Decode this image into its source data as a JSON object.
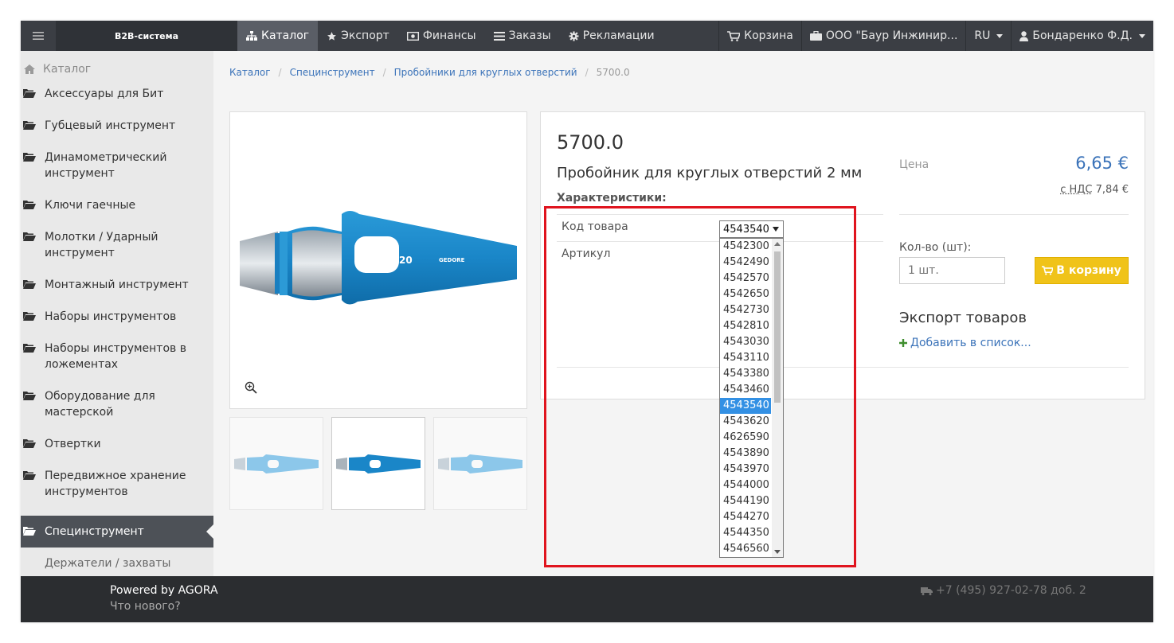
{
  "app": {
    "brand": "B2B-система"
  },
  "nav": {
    "items": [
      {
        "label": "Каталог",
        "icon": "sitemap-icon",
        "active": true
      },
      {
        "label": "Экспорт",
        "icon": "star-icon"
      },
      {
        "label": "Финансы",
        "icon": "money-icon"
      },
      {
        "label": "Заказы",
        "icon": "list-icon"
      },
      {
        "label": "Рекламации",
        "icon": "gear-icon"
      }
    ],
    "cart": "Корзина",
    "company": "ООО \"Баур Инжинир...",
    "lang": "RU",
    "user": "Бондаренко Ф.Д."
  },
  "sidebar": {
    "header": "Каталог",
    "items": [
      "Аксессуары для Бит",
      "Губцевый инструмент",
      "Динамометрический инструмент",
      "Ключи гаечные",
      "Молотки / Ударный инструмент",
      "Монтажный инструмент",
      "Наборы инструментов",
      "Наборы инструментов в ложементах",
      "Оборудование для мастерской",
      "Отвертки",
      "Передвижное хранение инструментов",
      "Специнструмент"
    ],
    "active_item": "Специнструмент",
    "sub_item": "Держатели / захваты"
  },
  "breadcrumb": {
    "items": [
      "Каталог",
      "Специнструмент",
      "Пробойники для круглых отверстий"
    ],
    "current": "5700.0"
  },
  "product": {
    "code": "5700.0",
    "name": "Пробойник для круглых отверстий 2 мм",
    "chars_label": "Характеристики:",
    "code_label": "Код товара",
    "article_label": "Артикул",
    "image_label_num": "20",
    "image_label_brand": "GEDORE"
  },
  "price": {
    "label": "Цена",
    "value": "6,65 €",
    "vat_label": "с НДС",
    "vat_value": "7,84 €"
  },
  "qty": {
    "label": "Кол-во (шт):",
    "placeholder": "1 шт."
  },
  "cart_button": "В корзину",
  "export": {
    "title": "Экспорт товаров",
    "add": "Добавить в список..."
  },
  "select": {
    "value": "4543540",
    "options": [
      "4542300",
      "4542490",
      "4542570",
      "4542650",
      "4542730",
      "4542810",
      "4543030",
      "4543110",
      "4543380",
      "4543460",
      "4543540",
      "4543620",
      "4626590",
      "4543890",
      "4543970",
      "4544000",
      "4544190",
      "4544270",
      "4544350",
      "4546560"
    ],
    "selected_index": 10
  },
  "footer": {
    "powered": "Powered by AGORA",
    "whats_new": "Что нового?",
    "phone": "+7 (495) 927-02-78 доб. 2"
  },
  "colors": {
    "topbar": "#3b3e44",
    "link": "#3b73b9",
    "cart_button": "#f0c319",
    "highlight": "#e0141e",
    "selected_option": "#3390e4"
  }
}
